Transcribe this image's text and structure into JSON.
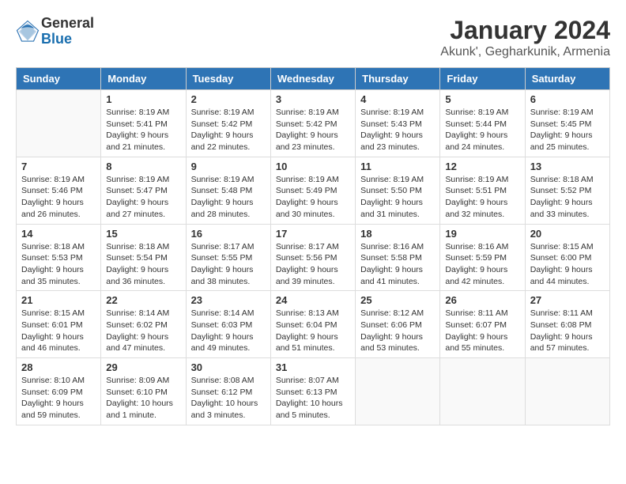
{
  "logo": {
    "general": "General",
    "blue": "Blue"
  },
  "title": "January 2024",
  "subtitle": "Akunk', Gegharkunik, Armenia",
  "days_of_week": [
    "Sunday",
    "Monday",
    "Tuesday",
    "Wednesday",
    "Thursday",
    "Friday",
    "Saturday"
  ],
  "weeks": [
    [
      {
        "day": "",
        "info": ""
      },
      {
        "day": "1",
        "info": "Sunrise: 8:19 AM\nSunset: 5:41 PM\nDaylight: 9 hours\nand 21 minutes."
      },
      {
        "day": "2",
        "info": "Sunrise: 8:19 AM\nSunset: 5:42 PM\nDaylight: 9 hours\nand 22 minutes."
      },
      {
        "day": "3",
        "info": "Sunrise: 8:19 AM\nSunset: 5:42 PM\nDaylight: 9 hours\nand 23 minutes."
      },
      {
        "day": "4",
        "info": "Sunrise: 8:19 AM\nSunset: 5:43 PM\nDaylight: 9 hours\nand 23 minutes."
      },
      {
        "day": "5",
        "info": "Sunrise: 8:19 AM\nSunset: 5:44 PM\nDaylight: 9 hours\nand 24 minutes."
      },
      {
        "day": "6",
        "info": "Sunrise: 8:19 AM\nSunset: 5:45 PM\nDaylight: 9 hours\nand 25 minutes."
      }
    ],
    [
      {
        "day": "7",
        "info": "Sunrise: 8:19 AM\nSunset: 5:46 PM\nDaylight: 9 hours\nand 26 minutes."
      },
      {
        "day": "8",
        "info": "Sunrise: 8:19 AM\nSunset: 5:47 PM\nDaylight: 9 hours\nand 27 minutes."
      },
      {
        "day": "9",
        "info": "Sunrise: 8:19 AM\nSunset: 5:48 PM\nDaylight: 9 hours\nand 28 minutes."
      },
      {
        "day": "10",
        "info": "Sunrise: 8:19 AM\nSunset: 5:49 PM\nDaylight: 9 hours\nand 30 minutes."
      },
      {
        "day": "11",
        "info": "Sunrise: 8:19 AM\nSunset: 5:50 PM\nDaylight: 9 hours\nand 31 minutes."
      },
      {
        "day": "12",
        "info": "Sunrise: 8:19 AM\nSunset: 5:51 PM\nDaylight: 9 hours\nand 32 minutes."
      },
      {
        "day": "13",
        "info": "Sunrise: 8:18 AM\nSunset: 5:52 PM\nDaylight: 9 hours\nand 33 minutes."
      }
    ],
    [
      {
        "day": "14",
        "info": "Sunrise: 8:18 AM\nSunset: 5:53 PM\nDaylight: 9 hours\nand 35 minutes."
      },
      {
        "day": "15",
        "info": "Sunrise: 8:18 AM\nSunset: 5:54 PM\nDaylight: 9 hours\nand 36 minutes."
      },
      {
        "day": "16",
        "info": "Sunrise: 8:17 AM\nSunset: 5:55 PM\nDaylight: 9 hours\nand 38 minutes."
      },
      {
        "day": "17",
        "info": "Sunrise: 8:17 AM\nSunset: 5:56 PM\nDaylight: 9 hours\nand 39 minutes."
      },
      {
        "day": "18",
        "info": "Sunrise: 8:16 AM\nSunset: 5:58 PM\nDaylight: 9 hours\nand 41 minutes."
      },
      {
        "day": "19",
        "info": "Sunrise: 8:16 AM\nSunset: 5:59 PM\nDaylight: 9 hours\nand 42 minutes."
      },
      {
        "day": "20",
        "info": "Sunrise: 8:15 AM\nSunset: 6:00 PM\nDaylight: 9 hours\nand 44 minutes."
      }
    ],
    [
      {
        "day": "21",
        "info": "Sunrise: 8:15 AM\nSunset: 6:01 PM\nDaylight: 9 hours\nand 46 minutes."
      },
      {
        "day": "22",
        "info": "Sunrise: 8:14 AM\nSunset: 6:02 PM\nDaylight: 9 hours\nand 47 minutes."
      },
      {
        "day": "23",
        "info": "Sunrise: 8:14 AM\nSunset: 6:03 PM\nDaylight: 9 hours\nand 49 minutes."
      },
      {
        "day": "24",
        "info": "Sunrise: 8:13 AM\nSunset: 6:04 PM\nDaylight: 9 hours\nand 51 minutes."
      },
      {
        "day": "25",
        "info": "Sunrise: 8:12 AM\nSunset: 6:06 PM\nDaylight: 9 hours\nand 53 minutes."
      },
      {
        "day": "26",
        "info": "Sunrise: 8:11 AM\nSunset: 6:07 PM\nDaylight: 9 hours\nand 55 minutes."
      },
      {
        "day": "27",
        "info": "Sunrise: 8:11 AM\nSunset: 6:08 PM\nDaylight: 9 hours\nand 57 minutes."
      }
    ],
    [
      {
        "day": "28",
        "info": "Sunrise: 8:10 AM\nSunset: 6:09 PM\nDaylight: 9 hours\nand 59 minutes."
      },
      {
        "day": "29",
        "info": "Sunrise: 8:09 AM\nSunset: 6:10 PM\nDaylight: 10 hours\nand 1 minute."
      },
      {
        "day": "30",
        "info": "Sunrise: 8:08 AM\nSunset: 6:12 PM\nDaylight: 10 hours\nand 3 minutes."
      },
      {
        "day": "31",
        "info": "Sunrise: 8:07 AM\nSunset: 6:13 PM\nDaylight: 10 hours\nand 5 minutes."
      },
      {
        "day": "",
        "info": ""
      },
      {
        "day": "",
        "info": ""
      },
      {
        "day": "",
        "info": ""
      }
    ]
  ]
}
